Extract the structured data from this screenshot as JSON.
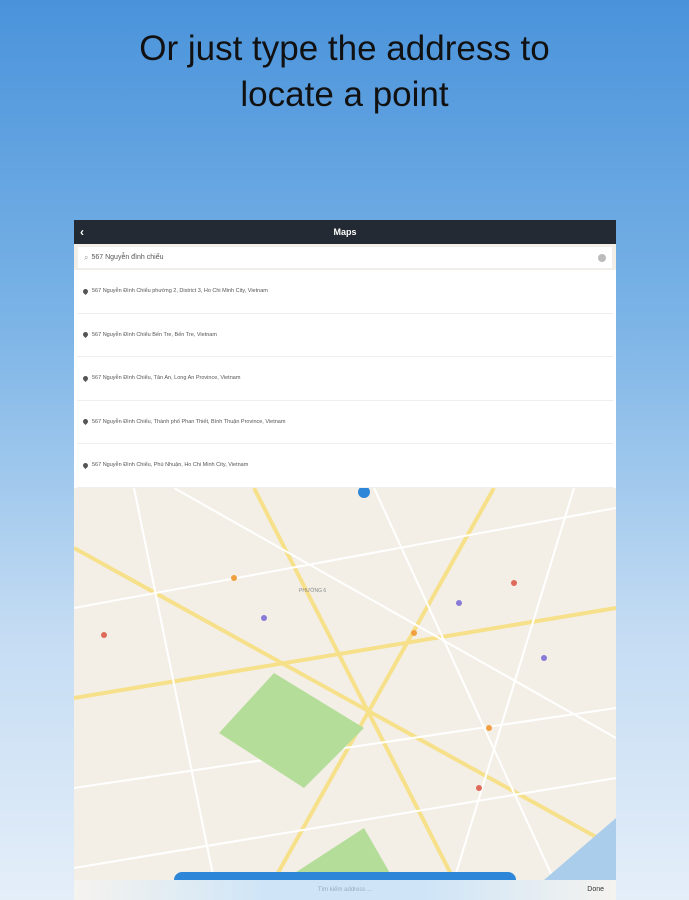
{
  "headline": {
    "line1": "Or just type the address to",
    "line2": "locate a point"
  },
  "app": {
    "title": "Maps",
    "back_icon": "chevron-left-icon"
  },
  "search": {
    "value": "567 Nguyễn đình chiểu"
  },
  "results": [
    "567 Nguyễn Đình Chiểu phường 2, District 3, Ho Chi Minh City, Vietnam",
    "567 Nguyễn Đình Chiểu Bến Tre, Bến Tre, Vietnam",
    "567 Nguyễn Đình Chiểu, Tân An, Long An Province, Vietnam",
    "567 Nguyễn Đình Chiểu, Thành phố Phan Thiết, Bình Thuận Province, Vietnam",
    "567 Nguyễn Đình Chiểu, Phú Nhuận, Ho Chi Minh City, Vietnam"
  ],
  "map": {
    "district_label": "PHƯỜNG 6"
  },
  "bottom": {
    "placeholder": "Tìm kiếm address ...",
    "done": "Done"
  }
}
